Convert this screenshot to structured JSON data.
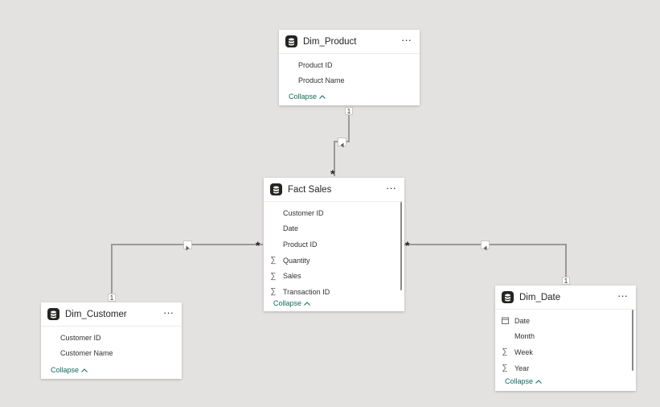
{
  "tables": [
    {
      "id": "dim-product",
      "name": "Dim_Product",
      "more_label": "···",
      "collapse_label": "Collapse",
      "fields": [
        {
          "label": "Product ID",
          "kind": "column"
        },
        {
          "label": "Product Name",
          "kind": "column"
        }
      ]
    },
    {
      "id": "fact-sales",
      "name": "Fact Sales",
      "more_label": "···",
      "collapse_label": "Collapse",
      "fields": [
        {
          "label": "Customer ID",
          "kind": "column"
        },
        {
          "label": "Date",
          "kind": "column"
        },
        {
          "label": "Product ID",
          "kind": "column"
        },
        {
          "label": "Quantity",
          "kind": "sum"
        },
        {
          "label": "Sales",
          "kind": "sum"
        },
        {
          "label": "Transaction ID",
          "kind": "sum"
        }
      ]
    },
    {
      "id": "dim-customer",
      "name": "Dim_Customer",
      "more_label": "···",
      "collapse_label": "Collapse",
      "fields": [
        {
          "label": "Customer ID",
          "kind": "column"
        },
        {
          "label": "Customer Name",
          "kind": "column"
        }
      ]
    },
    {
      "id": "dim-date",
      "name": "Dim_Date",
      "more_label": "···",
      "collapse_label": "Collapse",
      "fields": [
        {
          "label": "Date",
          "kind": "calendar"
        },
        {
          "label": "Month",
          "kind": "column"
        },
        {
          "label": "Week",
          "kind": "sum"
        },
        {
          "label": "Year",
          "kind": "sum"
        }
      ]
    }
  ],
  "relationships": [
    {
      "from": "Dim_Product",
      "to": "Fact Sales",
      "one_label": "1",
      "many_label": "*",
      "filter_direction": "single"
    },
    {
      "from": "Dim_Customer",
      "to": "Fact Sales",
      "one_label": "1",
      "many_label": "*",
      "filter_direction": "single"
    },
    {
      "from": "Dim_Date",
      "to": "Fact Sales",
      "one_label": "1",
      "many_label": "*",
      "filter_direction": "single"
    }
  ],
  "colors": {
    "canvas": "#e3e2e1",
    "card": "#ffffff",
    "link": "#0f6a60",
    "connector": "#9b9998"
  },
  "icons": {
    "table": "database-icon",
    "sum": "sigma-icon",
    "calendar": "calendar-icon",
    "more": "more-options-icon",
    "collapse": "chevron-up-icon",
    "direction": "triangle-arrow-icon"
  }
}
